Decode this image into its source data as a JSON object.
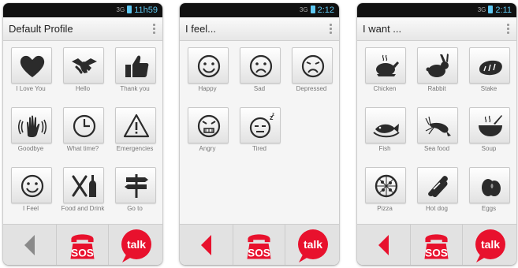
{
  "colors": {
    "accent": "#e8112d",
    "status_text": "#5ec8f2",
    "icon": "#2b2b2b",
    "back_disabled": "#8a8a8a"
  },
  "screens": [
    {
      "status": {
        "signal": "3G",
        "time": "11h59"
      },
      "title": "Default Profile",
      "back_enabled": false,
      "items": [
        {
          "label": "I Love You",
          "icon": "heart-icon"
        },
        {
          "label": "Hello",
          "icon": "handshake-icon"
        },
        {
          "label": "Thank you",
          "icon": "thumbs-up-icon"
        },
        {
          "label": "Goodbye",
          "icon": "waving-hand-icon"
        },
        {
          "label": "What time?",
          "icon": "clock-icon"
        },
        {
          "label": "Emergencies",
          "icon": "warning-icon"
        },
        {
          "label": "I Feel",
          "icon": "smiley-icon"
        },
        {
          "label": "Food and Drink",
          "icon": "cutlery-bottle-icon"
        },
        {
          "label": "Go to",
          "icon": "signpost-icon"
        }
      ],
      "bottom": {
        "back": "back-arrow-icon",
        "sos": "SOS",
        "talk": "talk"
      }
    },
    {
      "status": {
        "signal": "3G",
        "time": "2:12"
      },
      "title": "I feel...",
      "back_enabled": true,
      "items": [
        {
          "label": "Happy",
          "icon": "happy-face-icon"
        },
        {
          "label": "Sad",
          "icon": "sad-face-icon"
        },
        {
          "label": "Depressed",
          "icon": "depressed-face-icon"
        },
        {
          "label": "Angry",
          "icon": "angry-face-icon"
        },
        {
          "label": "Tired",
          "icon": "tired-face-icon"
        }
      ],
      "bottom": {
        "back": "back-arrow-icon",
        "sos": "SOS",
        "talk": "talk"
      }
    },
    {
      "status": {
        "signal": "3G",
        "time": "2:11"
      },
      "title": "I want ...",
      "back_enabled": true,
      "items": [
        {
          "label": "Chicken",
          "icon": "roast-chicken-icon"
        },
        {
          "label": "Rabbit",
          "icon": "rabbit-icon"
        },
        {
          "label": "Stake",
          "icon": "steak-icon"
        },
        {
          "label": "Fish",
          "icon": "fish-dish-icon"
        },
        {
          "label": "Sea food",
          "icon": "shrimp-icon"
        },
        {
          "label": "Soup",
          "icon": "soup-bowl-icon"
        },
        {
          "label": "Pizza",
          "icon": "pizza-icon"
        },
        {
          "label": "Hot dog",
          "icon": "hot-dog-icon"
        },
        {
          "label": "Eggs",
          "icon": "eggs-icon"
        }
      ],
      "bottom": {
        "back": "back-arrow-icon",
        "sos": "SOS",
        "talk": "talk"
      }
    }
  ]
}
